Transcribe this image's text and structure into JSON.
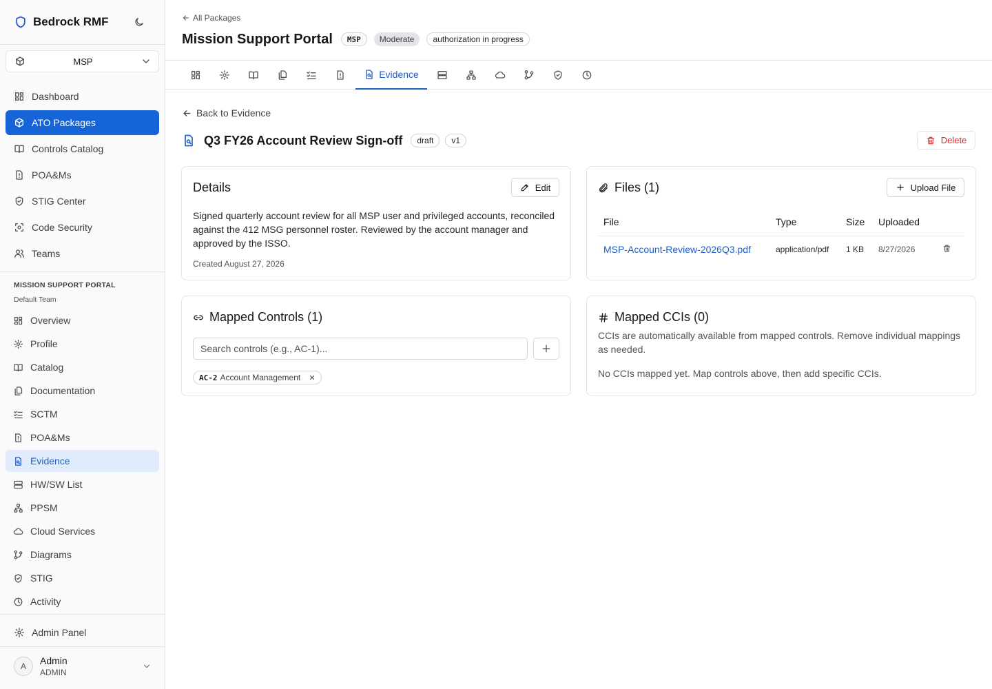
{
  "app": {
    "name": "Bedrock RMF"
  },
  "package_selector": {
    "value": "MSP"
  },
  "nav": {
    "dashboard": "Dashboard",
    "ato_packages": "ATO Packages",
    "controls_catalog": "Controls Catalog",
    "poams": "POA&Ms",
    "stig_center": "STIG Center",
    "code_security": "Code Security",
    "teams": "Teams"
  },
  "package_section": {
    "title": "MISSION SUPPORT PORTAL",
    "team": "Default Team",
    "items": {
      "overview": "Overview",
      "profile": "Profile",
      "catalog": "Catalog",
      "documentation": "Documentation",
      "sctm": "SCTM",
      "poams": "POA&Ms",
      "evidence": "Evidence",
      "hwsw": "HW/SW List",
      "ppsm": "PPSM",
      "cloud": "Cloud Services",
      "diagrams": "Diagrams",
      "stig": "STIG",
      "activity": "Activity"
    }
  },
  "admin_panel": "Admin Panel",
  "user": {
    "initial": "A",
    "name": "Admin",
    "role": "ADMIN"
  },
  "header": {
    "breadcrumb": "All Packages",
    "title": "Mission Support Portal",
    "acronym": "MSP",
    "impact": "Moderate",
    "status": "authorization in progress"
  },
  "tabs": {
    "active_label": "Evidence"
  },
  "evidence": {
    "back_label": "Back to Evidence",
    "title": "Q3 FY26 Account Review Sign-off",
    "status": "draft",
    "version": "v1",
    "delete_label": "Delete"
  },
  "details": {
    "title": "Details",
    "edit_label": "Edit",
    "description": "Signed quarterly account review for all MSP user and privileged accounts, reconciled against the 412 MSG personnel roster. Reviewed by the account manager and approved by the ISSO.",
    "created": "Created August 27, 2026"
  },
  "files": {
    "title": "Files (1)",
    "upload_label": "Upload File",
    "columns": {
      "file": "File",
      "type": "Type",
      "size": "Size",
      "uploaded": "Uploaded"
    },
    "rows": [
      {
        "name": "MSP-Account-Review-2026Q3.pdf",
        "type": "application/pdf",
        "size": "1 KB",
        "uploaded": "8/27/2026"
      }
    ]
  },
  "mapped_controls": {
    "title": "Mapped Controls (1)",
    "search_placeholder": "Search controls (e.g., AC-1)...",
    "chips": [
      {
        "code": "AC-2",
        "name": "Account Management"
      }
    ]
  },
  "mapped_ccis": {
    "title": "Mapped CCIs (0)",
    "description": "CCIs are automatically available from mapped controls. Remove individual mappings as needed.",
    "empty": "No CCIs mapped yet. Map controls above, then add specific CCIs."
  },
  "colors": {
    "accent": "#1565d8",
    "danger": "#dc2626",
    "active_sub_bg": "#e0ebfb"
  }
}
